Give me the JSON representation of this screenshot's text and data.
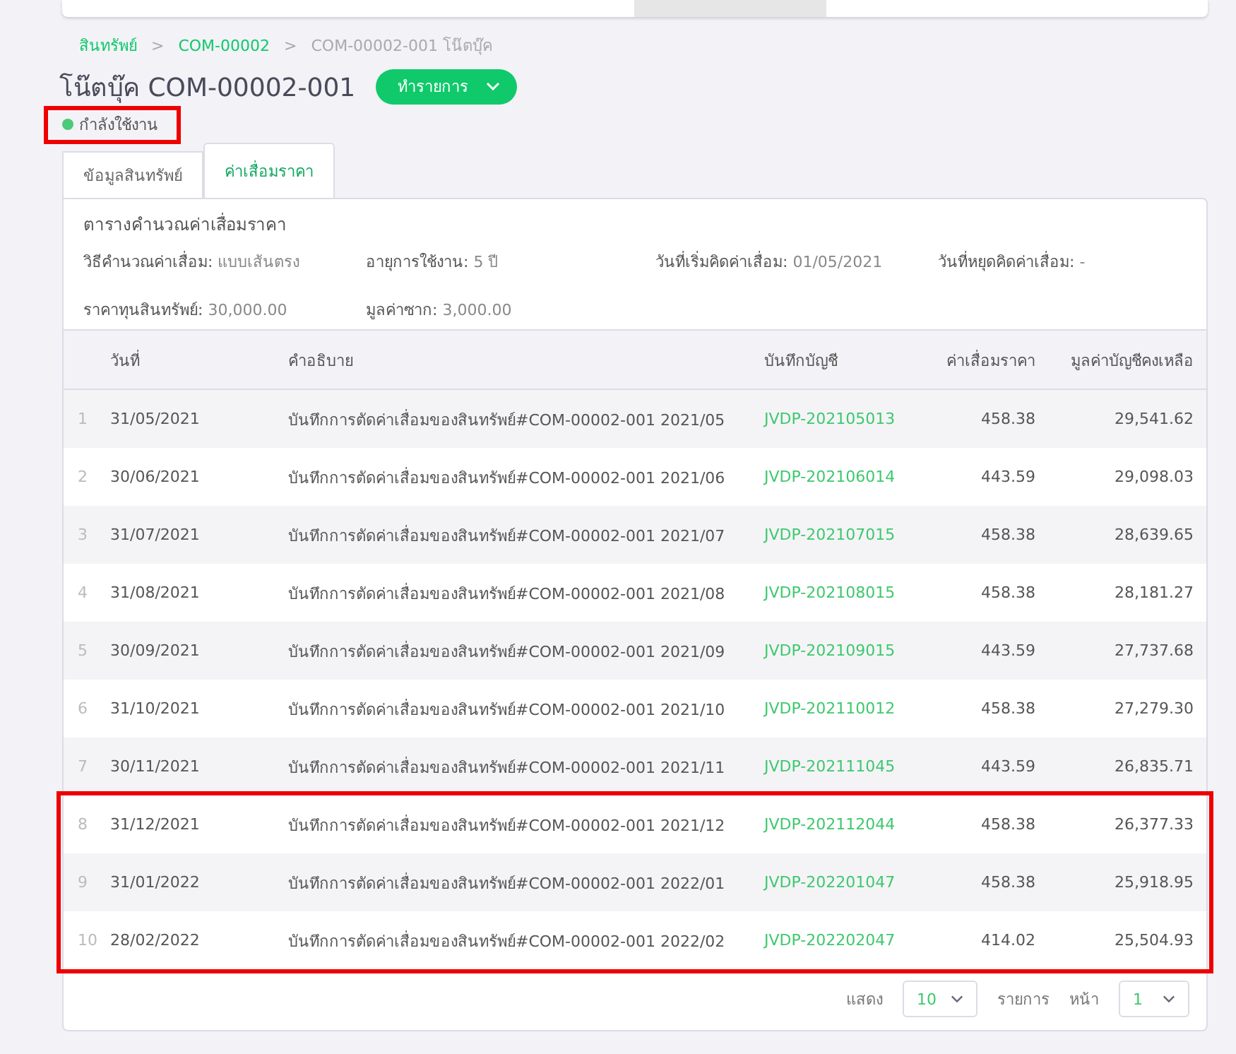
{
  "breadcrumb": [
    {
      "label": "สินทรัพย์",
      "link": true
    },
    {
      "separator": ">",
      "label": "COM-00002",
      "link": true
    },
    {
      "separator": ">",
      "label": "COM-00002-001 โน๊ตบุ๊ค",
      "link": false
    }
  ],
  "title": "โน๊ตบุ๊ค COM-00002-001",
  "action_button": "ทำรายการ",
  "status": {
    "label": "กำลังใช้งาน",
    "color": "#4cc97a",
    "highlighted": true
  },
  "tabs": [
    {
      "label": "ข้อมูลสินทรัพย์",
      "selected": false
    },
    {
      "label": "ค่าเสื่อมราคา",
      "selected": true
    }
  ],
  "section_title": "ตารางคำนวณค่าเสื่อมราคา",
  "info": [
    {
      "label": "วิธีคำนวณค่าเสื่อม:",
      "value": "แบบเส้นตรง"
    },
    {
      "label": "อายุการใช้งาน:",
      "value": "5 ปี"
    },
    {
      "label": "วันที่เริ่มคิดค่าเสื่อม:",
      "value": "01/05/2021"
    },
    {
      "label": "วันที่หยุดคิดค่าเสื่อม:",
      "value": "-"
    },
    {
      "label": "ราคาทุนสินทรัพย์:",
      "value": "30,000.00"
    },
    {
      "label": "มูลค่าซาก:",
      "value": "3,000.00"
    }
  ],
  "table": {
    "columns": [
      "วันที่",
      "คำอธิบาย",
      "บันทึกบัญชี",
      "ค่าเสื่อมราคา",
      "มูลค่าบัญชีคงเหลือ"
    ],
    "rows": [
      {
        "no": "1",
        "date": "31/05/2021",
        "description": "บันทึกการตัดค่าเสื่อมของสินทรัพย์#COM-00002-001 2021/05",
        "journal": "JVDP-202105013",
        "depreciation": "458.38",
        "book_value": "29,541.62",
        "highlighted": false
      },
      {
        "no": "2",
        "date": "30/06/2021",
        "description": "บันทึกการตัดค่าเสื่อมของสินทรัพย์#COM-00002-001 2021/06",
        "journal": "JVDP-202106014",
        "depreciation": "443.59",
        "book_value": "29,098.03",
        "highlighted": false
      },
      {
        "no": "3",
        "date": "31/07/2021",
        "description": "บันทึกการตัดค่าเสื่อมของสินทรัพย์#COM-00002-001 2021/07",
        "journal": "JVDP-202107015",
        "depreciation": "458.38",
        "book_value": "28,639.65",
        "highlighted": false
      },
      {
        "no": "4",
        "date": "31/08/2021",
        "description": "บันทึกการตัดค่าเสื่อมของสินทรัพย์#COM-00002-001 2021/08",
        "journal": "JVDP-202108015",
        "depreciation": "458.38",
        "book_value": "28,181.27",
        "highlighted": false
      },
      {
        "no": "5",
        "date": "30/09/2021",
        "description": "บันทึกการตัดค่าเสื่อมของสินทรัพย์#COM-00002-001 2021/09",
        "journal": "JVDP-202109015",
        "depreciation": "443.59",
        "book_value": "27,737.68",
        "highlighted": false
      },
      {
        "no": "6",
        "date": "31/10/2021",
        "description": "บันทึกการตัดค่าเสื่อมของสินทรัพย์#COM-00002-001 2021/10",
        "journal": "JVDP-202110012",
        "depreciation": "458.38",
        "book_value": "27,279.30",
        "highlighted": false
      },
      {
        "no": "7",
        "date": "30/11/2021",
        "description": "บันทึกการตัดค่าเสื่อมของสินทรัพย์#COM-00002-001 2021/11",
        "journal": "JVDP-202111045",
        "depreciation": "443.59",
        "book_value": "26,835.71",
        "highlighted": false
      },
      {
        "no": "8",
        "date": "31/12/2021",
        "description": "บันทึกการตัดค่าเสื่อมของสินทรัพย์#COM-00002-001 2021/12",
        "journal": "JVDP-202112044",
        "depreciation": "458.38",
        "book_value": "26,377.33",
        "highlighted": true
      },
      {
        "no": "9",
        "date": "31/01/2022",
        "description": "บันทึกการตัดค่าเสื่อมของสินทรัพย์#COM-00002-001 2022/01",
        "journal": "JVDP-202201047",
        "depreciation": "458.38",
        "book_value": "25,918.95",
        "highlighted": true
      },
      {
        "no": "10",
        "date": "28/02/2022",
        "description": "บันทึกการตัดค่าเสื่อมของสินทรัพย์#COM-00002-001 2022/02",
        "journal": "JVDP-202202047",
        "depreciation": "414.02",
        "book_value": "25,504.93",
        "highlighted": true
      }
    ]
  },
  "pagination": {
    "show_label": "แสดง",
    "page_size": "10",
    "items_label": "รายการ",
    "page_label": "หน้า",
    "page": "1"
  }
}
